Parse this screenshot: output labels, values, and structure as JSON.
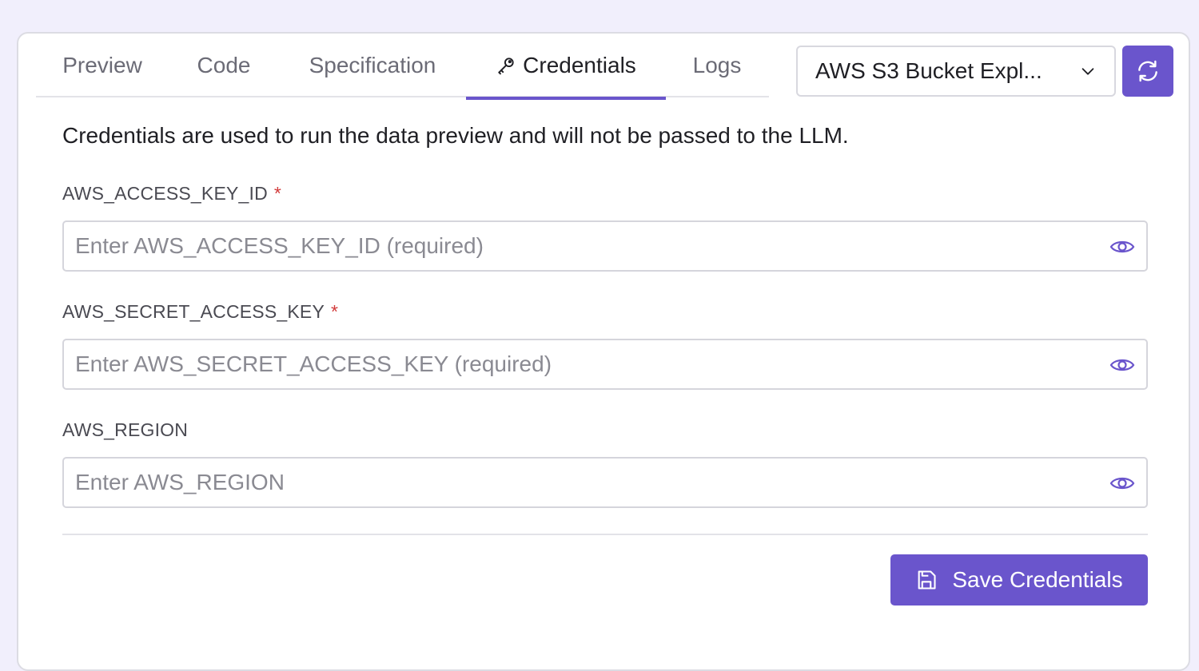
{
  "tabs": [
    {
      "label": "Preview"
    },
    {
      "label": "Code"
    },
    {
      "label": "Specification"
    },
    {
      "label": "Credentials",
      "active": true
    },
    {
      "label": "Logs"
    }
  ],
  "connector_select": {
    "value": "AWS S3 Bucket Expl..."
  },
  "info_text": "Credentials are used to run the data preview and will not be passed to the LLM.",
  "fields": [
    {
      "label": "AWS_ACCESS_KEY_ID",
      "required": "*",
      "placeholder": "Enter AWS_ACCESS_KEY_ID (required)",
      "value": ""
    },
    {
      "label": "AWS_SECRET_ACCESS_KEY",
      "required": "*",
      "placeholder": "Enter AWS_SECRET_ACCESS_KEY (required)",
      "value": ""
    },
    {
      "label": "AWS_REGION",
      "required": "",
      "placeholder": "Enter AWS_REGION",
      "value": ""
    }
  ],
  "save_button": {
    "label": "Save Credentials"
  },
  "colors": {
    "accent": "#6a55cc",
    "required": "#d23a3a",
    "background": "#f1effc"
  },
  "icons": {
    "credentials_tab": "key-icon",
    "select": "chevron-down-icon",
    "refresh": "refresh-icon",
    "field": "eye-icon",
    "save": "save-icon"
  }
}
